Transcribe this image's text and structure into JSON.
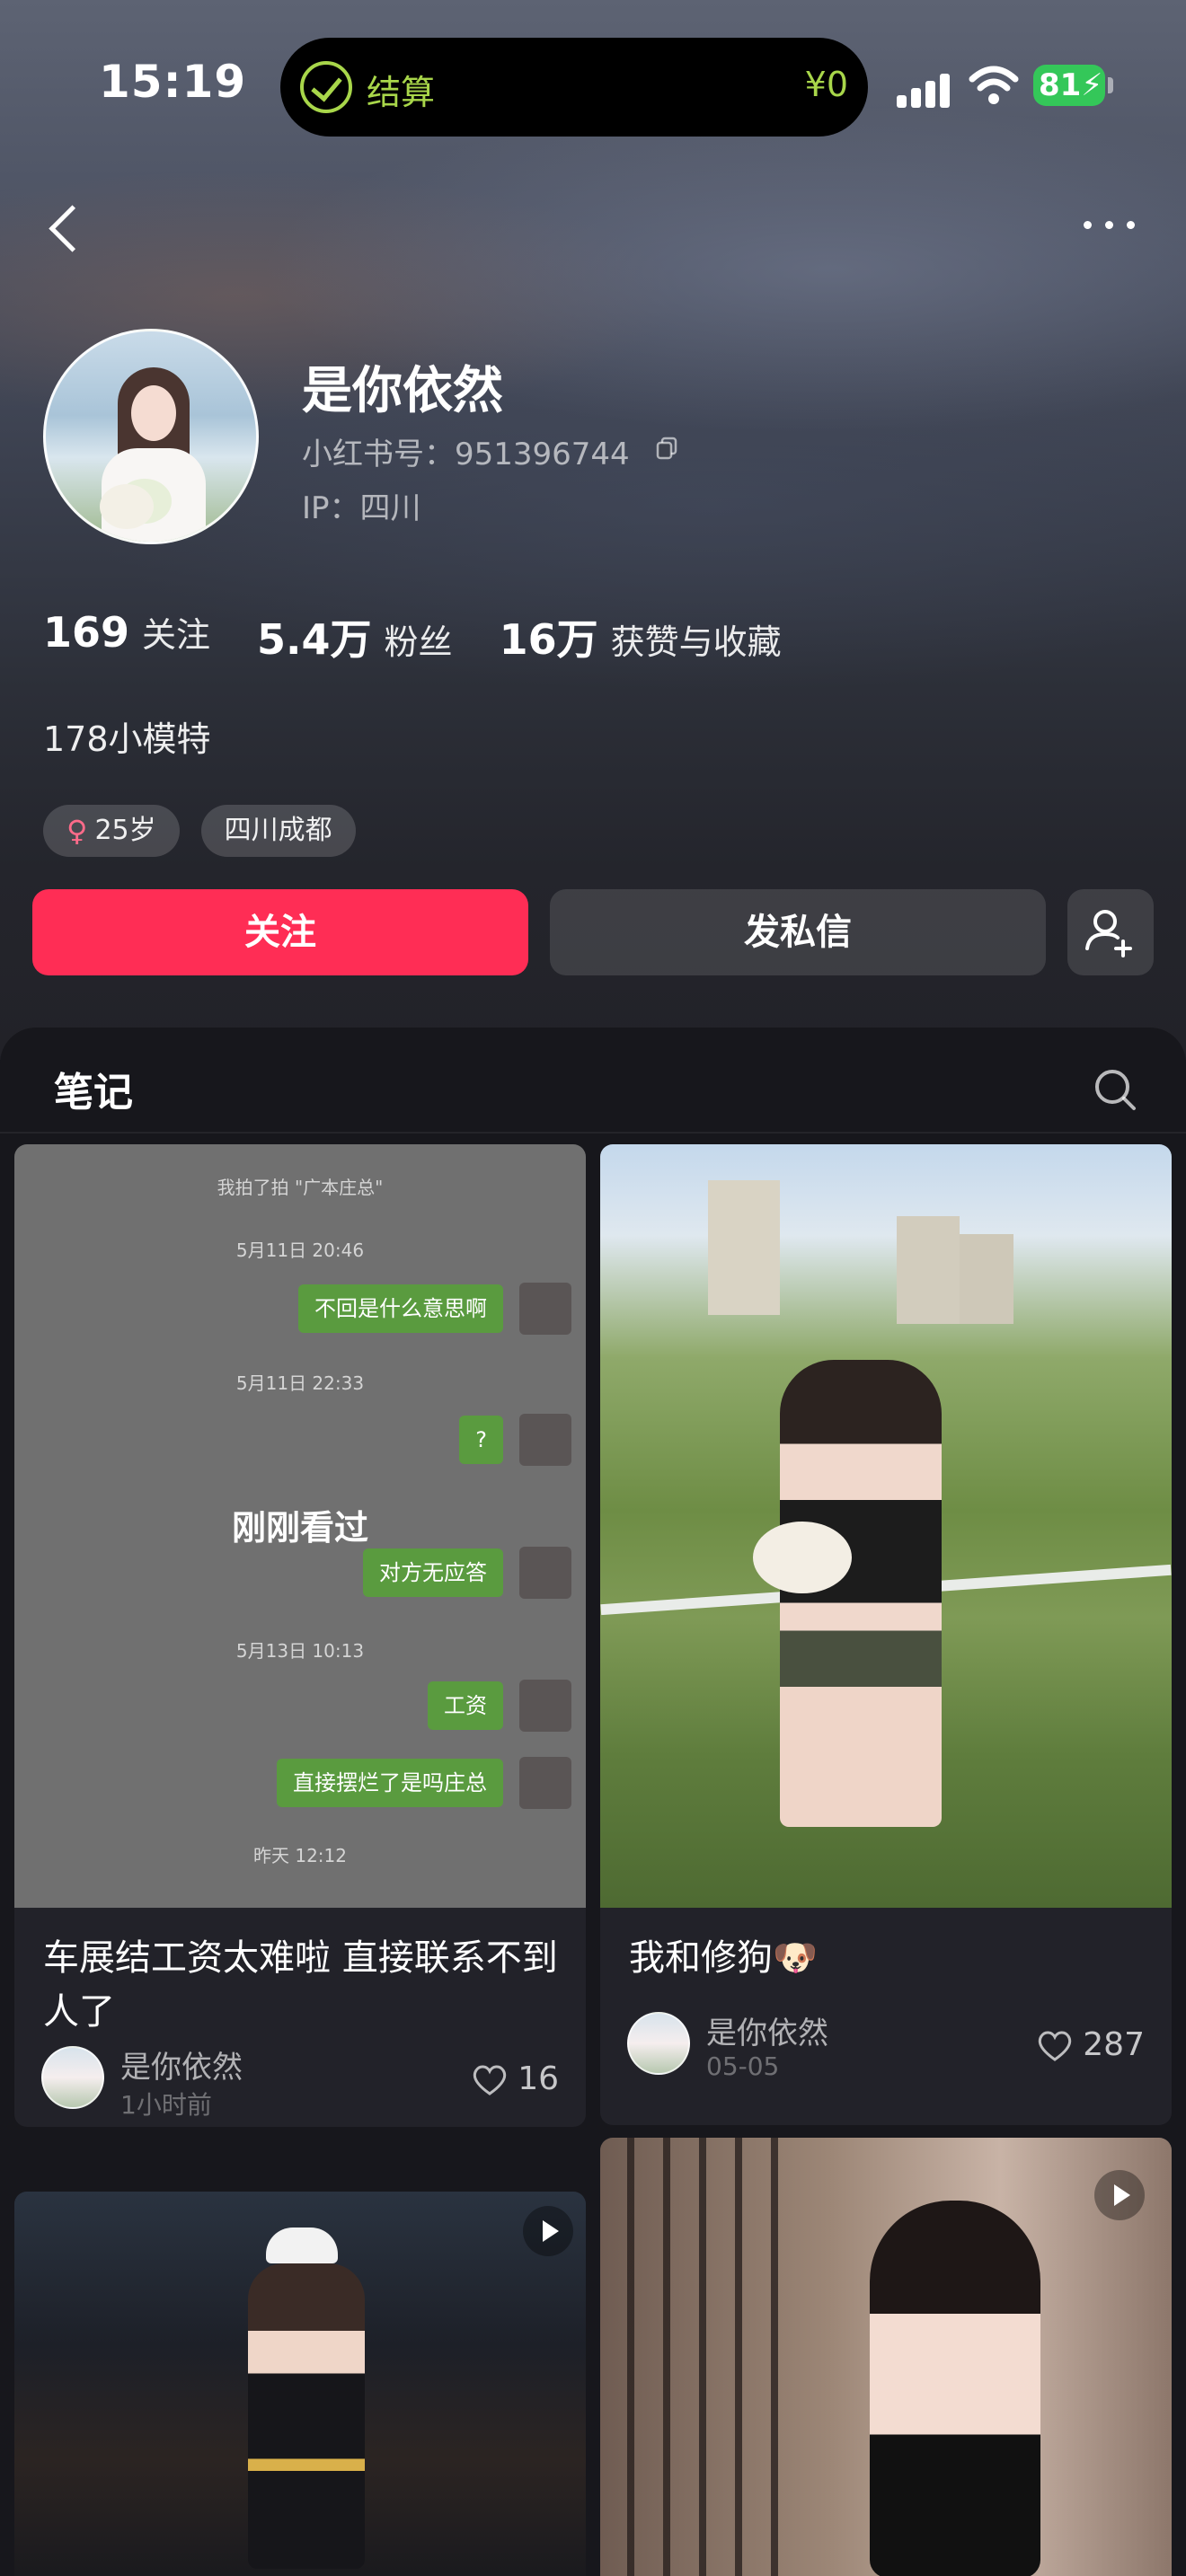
{
  "status_bar": {
    "time": "15:19",
    "island_label": "结算",
    "island_amount": "¥0",
    "battery": "81"
  },
  "profile": {
    "name": "是你依然",
    "red_id": "小红书号：951396744",
    "ip": "IP：四川",
    "stats": [
      {
        "num": "169",
        "label": "关注"
      },
      {
        "num": "5.4万",
        "label": "粉丝"
      },
      {
        "num": "16万",
        "label": "获赞与收藏"
      }
    ],
    "bio": "178小模特",
    "tags": [
      {
        "text": "25岁",
        "icon": "female-icon"
      },
      {
        "text": "四川成都"
      }
    ]
  },
  "actions": {
    "follow": "关注",
    "message": "发私信"
  },
  "tabs": {
    "notes": "笔记"
  },
  "notes": [
    {
      "title": "车展结工资太难啦 直接联系不到人了",
      "author": "是你依然",
      "time": "1小时前",
      "likes": "16",
      "overlay": "刚刚看过",
      "chat": {
        "top_text": "我拍了拍 \"广本庄总\"",
        "stamps": [
          "5月11日 20:46",
          "5月11日 22:33",
          "5月13日 10:13",
          "昨天 12:12"
        ],
        "bubbles": [
          "不回是什么意思啊",
          "?",
          "对方无应答",
          "工资",
          "直接摆烂了是吗庄总"
        ]
      }
    },
    {
      "title": "我和修狗🐶",
      "author": "是你依然",
      "time": "05-05",
      "likes": "287"
    }
  ],
  "colors": {
    "accent": "#ff2d55",
    "island_green": "#a8d64a",
    "battery_green": "#34c759"
  }
}
